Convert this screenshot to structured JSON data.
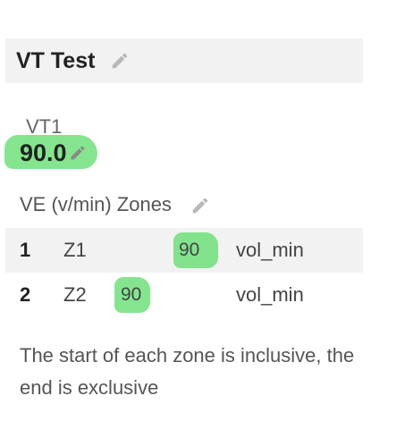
{
  "header": {
    "title": "VT Test",
    "edit_icon": "pencil-icon"
  },
  "vt": {
    "label": "VT1",
    "value": "90.0",
    "edit_icon": "pencil-icon"
  },
  "zones": {
    "heading": "VE (v/min) Zones",
    "edit_icon": "pencil-icon",
    "rows": [
      {
        "num": "1",
        "name": "Z1",
        "value": "90",
        "unit": "vol_min"
      },
      {
        "num": "2",
        "name": "Z2",
        "value": "90",
        "unit": "vol_min"
      }
    ]
  },
  "note": "The start of each zone is inclusive, the end is exclusive",
  "colors": {
    "highlight": "#6fe07a",
    "row_background": "#f2f2f2"
  }
}
